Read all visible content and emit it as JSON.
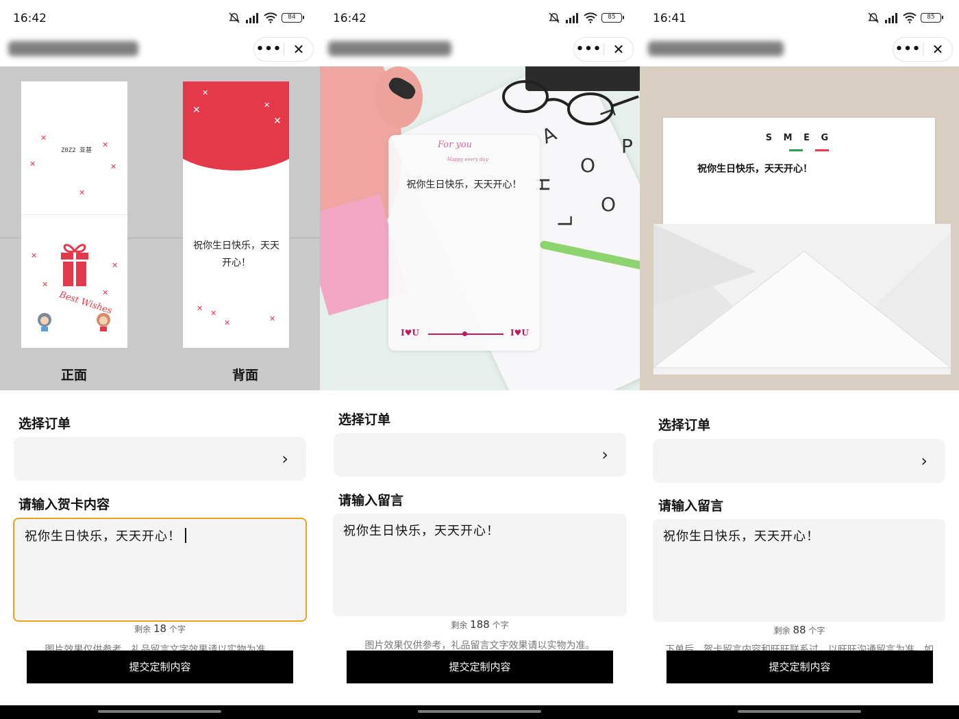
{
  "panels": [
    {
      "status": {
        "time": "16:42",
        "battery": "84"
      },
      "preview": {
        "front_label": "正面",
        "back_label": "背面",
        "card_message": "祝你生日快乐，天天开心！",
        "script_text": "Best Wishes",
        "brand_small": "Z0Z2 亚甚"
      },
      "order_section_title": "选择订单",
      "message_section_title": "请输入贺卡内容",
      "message_value": "祝你生日快乐，天天开心！",
      "remaining_prefix": "剩余",
      "remaining_count": "18",
      "remaining_suffix": "个字",
      "note": "图片效果仅供参考，礼品留言文字效果请以实物为准。",
      "submit_label": "提交定制内容"
    },
    {
      "status": {
        "time": "16:42",
        "battery": "85"
      },
      "preview": {
        "for_you": "For you",
        "happy_day": "Happy every day",
        "card_message": "祝你生日快乐，天天开心！",
        "iou_left": "I♥U",
        "iou_right": "I♥U"
      },
      "order_section_title": "选择订单",
      "message_section_title": "请输入留言",
      "message_value": "祝你生日快乐，天天开心！",
      "remaining_prefix": "剩余",
      "remaining_count": "188",
      "remaining_suffix": "个字",
      "note": "图片效果仅供参考，礼品留言文字效果请以实物为准。",
      "submit_label": "提交定制内容"
    },
    {
      "status": {
        "time": "16:41",
        "battery": "85"
      },
      "preview": {
        "brand": "S M E G",
        "card_message": "祝你生日快乐，天天开心！"
      },
      "order_section_title": "选择订单",
      "message_section_title": "请输入留言",
      "message_value": "祝你生日快乐，天天开心！",
      "remaining_prefix": "剩余",
      "remaining_count": "88",
      "remaining_suffix": "个字",
      "note": "下单后，贺卡留言内容和旺旺联系过，以旺旺沟通留言为准。如",
      "submit_label": "提交定制内容"
    }
  ],
  "icons": [
    "mute-icon",
    "signal-icon",
    "wifi-icon",
    "battery-icon",
    "more-icon",
    "close-icon",
    "chevron-right-icon"
  ],
  "colors": {
    "accent_border": "#e9a41c",
    "card_red": "#e3394a",
    "button_black": "#000000"
  }
}
